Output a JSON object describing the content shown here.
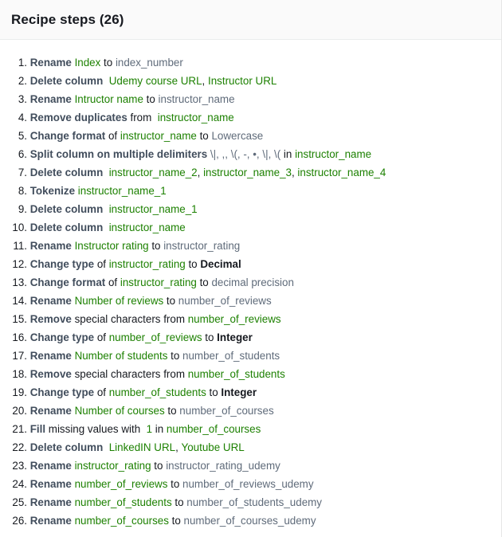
{
  "panel": {
    "title": "Recipe steps (26)"
  },
  "steps": [
    {
      "n": "1.",
      "parts": [
        {
          "c": "k",
          "t": "Rename "
        },
        {
          "c": "g",
          "t": "Index"
        },
        {
          "c": "s",
          "t": " to "
        },
        {
          "c": "t",
          "t": "index_number"
        }
      ]
    },
    {
      "n": "2.",
      "parts": [
        {
          "c": "k",
          "t": "Delete column "
        },
        {
          "c": "g",
          "t": " Udemy course URL"
        },
        {
          "c": "s",
          "t": ", "
        },
        {
          "c": "g",
          "t": "Instructor URL"
        }
      ]
    },
    {
      "n": "3.",
      "parts": [
        {
          "c": "k",
          "t": "Rename "
        },
        {
          "c": "g",
          "t": "Intructor name"
        },
        {
          "c": "s",
          "t": " to "
        },
        {
          "c": "t",
          "t": "instructor_name"
        }
      ]
    },
    {
      "n": "4.",
      "parts": [
        {
          "c": "k",
          "t": "Remove duplicates"
        },
        {
          "c": "s",
          "t": " from "
        },
        {
          "c": "g",
          "t": " instructor_name"
        }
      ]
    },
    {
      "n": "5.",
      "parts": [
        {
          "c": "k",
          "t": "Change format"
        },
        {
          "c": "s",
          "t": " of "
        },
        {
          "c": "g",
          "t": "instructor_name"
        },
        {
          "c": "s",
          "t": " to "
        },
        {
          "c": "t",
          "t": "Lowercase"
        }
      ]
    },
    {
      "n": "6.",
      "parts": [
        {
          "c": "k",
          "t": "Split column on multiple delimiters "
        },
        {
          "c": "t",
          "t": "\\|, ,, \\(, -, •, \\|, \\("
        },
        {
          "c": "s",
          "t": " in "
        },
        {
          "c": "g",
          "t": "instructor_name"
        }
      ]
    },
    {
      "n": "7.",
      "parts": [
        {
          "c": "k",
          "t": "Delete column "
        },
        {
          "c": "g",
          "t": " instructor_name_2"
        },
        {
          "c": "s",
          "t": ", "
        },
        {
          "c": "g",
          "t": "instructor_name_3"
        },
        {
          "c": "s",
          "t": ", "
        },
        {
          "c": "g",
          "t": "instructor_name_4"
        }
      ]
    },
    {
      "n": "8.",
      "parts": [
        {
          "c": "k",
          "t": "Tokenize "
        },
        {
          "c": "g",
          "t": "instructor_name_1"
        }
      ]
    },
    {
      "n": "9.",
      "parts": [
        {
          "c": "k",
          "t": "Delete column "
        },
        {
          "c": "g",
          "t": " instructor_name_1"
        }
      ]
    },
    {
      "n": "10.",
      "parts": [
        {
          "c": "k",
          "t": "Delete column "
        },
        {
          "c": "g",
          "t": " instructor_name"
        }
      ]
    },
    {
      "n": "11.",
      "parts": [
        {
          "c": "k",
          "t": "Rename "
        },
        {
          "c": "g",
          "t": "Instructor rating"
        },
        {
          "c": "s",
          "t": " to "
        },
        {
          "c": "t",
          "t": "instructor_rating"
        }
      ]
    },
    {
      "n": "12.",
      "parts": [
        {
          "c": "k",
          "t": "Change type"
        },
        {
          "c": "s",
          "t": " of "
        },
        {
          "c": "g",
          "t": "instructor_rating"
        },
        {
          "c": "s",
          "t": " to "
        },
        {
          "c": "b",
          "t": "Decimal"
        }
      ]
    },
    {
      "n": "13.",
      "parts": [
        {
          "c": "k",
          "t": "Change format"
        },
        {
          "c": "s",
          "t": " of "
        },
        {
          "c": "g",
          "t": "instructor_rating"
        },
        {
          "c": "s",
          "t": " to "
        },
        {
          "c": "t",
          "t": "decimal precision"
        }
      ]
    },
    {
      "n": "14.",
      "parts": [
        {
          "c": "k",
          "t": "Rename "
        },
        {
          "c": "g",
          "t": "Number of reviews"
        },
        {
          "c": "s",
          "t": " to "
        },
        {
          "c": "t",
          "t": "number_of_reviews"
        }
      ]
    },
    {
      "n": "15.",
      "parts": [
        {
          "c": "k",
          "t": "Remove"
        },
        {
          "c": "s",
          "t": " special characters from "
        },
        {
          "c": "g",
          "t": "number_of_reviews"
        }
      ]
    },
    {
      "n": "16.",
      "parts": [
        {
          "c": "k",
          "t": "Change type"
        },
        {
          "c": "s",
          "t": " of "
        },
        {
          "c": "g",
          "t": "number_of_reviews"
        },
        {
          "c": "s",
          "t": " to "
        },
        {
          "c": "b",
          "t": "Integer"
        }
      ]
    },
    {
      "n": "17.",
      "parts": [
        {
          "c": "k",
          "t": "Rename "
        },
        {
          "c": "g",
          "t": "Number of students"
        },
        {
          "c": "s",
          "t": " to "
        },
        {
          "c": "t",
          "t": "number_of_students"
        }
      ]
    },
    {
      "n": "18.",
      "parts": [
        {
          "c": "k",
          "t": "Remove"
        },
        {
          "c": "s",
          "t": " special characters from "
        },
        {
          "c": "g",
          "t": "number_of_students"
        }
      ]
    },
    {
      "n": "19.",
      "parts": [
        {
          "c": "k",
          "t": "Change type"
        },
        {
          "c": "s",
          "t": " of "
        },
        {
          "c": "g",
          "t": "number_of_students"
        },
        {
          "c": "s",
          "t": " to "
        },
        {
          "c": "b",
          "t": "Integer"
        }
      ]
    },
    {
      "n": "20.",
      "parts": [
        {
          "c": "k",
          "t": "Rename "
        },
        {
          "c": "g",
          "t": "Number of courses"
        },
        {
          "c": "s",
          "t": " to "
        },
        {
          "c": "t",
          "t": "number_of_courses"
        }
      ]
    },
    {
      "n": "21.",
      "parts": [
        {
          "c": "k",
          "t": "Fill"
        },
        {
          "c": "s",
          "t": " missing values with "
        },
        {
          "c": "g",
          "t": " 1"
        },
        {
          "c": "s",
          "t": " in "
        },
        {
          "c": "g",
          "t": "number_of_courses"
        }
      ]
    },
    {
      "n": "22.",
      "parts": [
        {
          "c": "k",
          "t": "Delete column "
        },
        {
          "c": "g",
          "t": " LinkedIN URL"
        },
        {
          "c": "s",
          "t": ", "
        },
        {
          "c": "g",
          "t": "Youtube URL"
        }
      ]
    },
    {
      "n": "23.",
      "parts": [
        {
          "c": "k",
          "t": "Rename "
        },
        {
          "c": "g",
          "t": "instructor_rating"
        },
        {
          "c": "s",
          "t": " to "
        },
        {
          "c": "t",
          "t": "instructor_rating_udemy"
        }
      ]
    },
    {
      "n": "24.",
      "parts": [
        {
          "c": "k",
          "t": "Rename "
        },
        {
          "c": "g",
          "t": "number_of_reviews"
        },
        {
          "c": "s",
          "t": " to "
        },
        {
          "c": "t",
          "t": "number_of_reviews_udemy"
        }
      ]
    },
    {
      "n": "25.",
      "parts": [
        {
          "c": "k",
          "t": "Rename "
        },
        {
          "c": "g",
          "t": "number_of_students"
        },
        {
          "c": "s",
          "t": " to "
        },
        {
          "c": "t",
          "t": "number_of_students_udemy"
        }
      ]
    },
    {
      "n": "26.",
      "parts": [
        {
          "c": "k",
          "t": "Rename "
        },
        {
          "c": "g",
          "t": "number_of_courses"
        },
        {
          "c": "s",
          "t": " to "
        },
        {
          "c": "t",
          "t": "number_of_courses_udemy"
        }
      ]
    }
  ],
  "colors": {
    "keyword": "#414d5c",
    "column": "#1d8102",
    "target": "#5f6b7a",
    "text": "#16191f"
  }
}
